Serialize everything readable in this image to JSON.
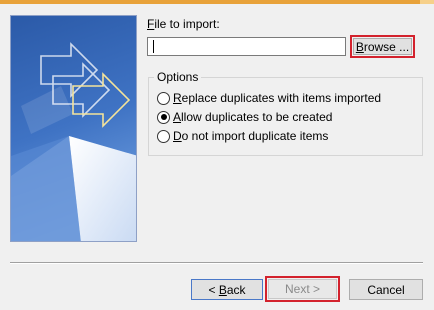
{
  "file": {
    "label_accel": "F",
    "label_rest": "ile to import:",
    "value": ""
  },
  "browse": {
    "label_accel": "B",
    "label_rest": "rowse ..."
  },
  "options": {
    "legend": "Options",
    "items": [
      {
        "accel": "R",
        "rest": "eplace duplicates with items imported",
        "checked": false
      },
      {
        "accel": "A",
        "rest": "llow duplicates to be created",
        "checked": true
      },
      {
        "accel": "D",
        "rest": "o not import duplicate items",
        "checked": false
      }
    ]
  },
  "nav": {
    "back_prefix": "< ",
    "back_accel": "B",
    "back_rest": "ack",
    "next_label": "Next >",
    "cancel_label": "Cancel"
  },
  "colors": {
    "highlight": "#d3222d",
    "graphic_bg": "#2c5aa8",
    "accent_strip": "#e8a23a"
  },
  "icons": [
    "wizard-graphic",
    "radio-button"
  ]
}
